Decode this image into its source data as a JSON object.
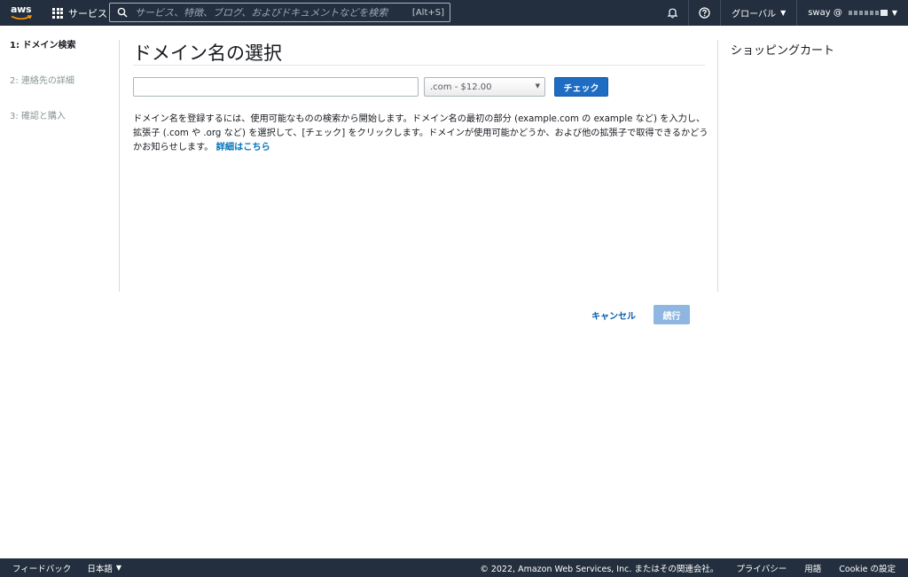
{
  "header": {
    "logo_text": "aws",
    "services_label": "サービス",
    "search_placeholder": "サービス、特徴、ブログ、およびドキュメントなどを検索",
    "search_shortcut": "[Alt+S]",
    "region_label": "グローバル",
    "account_label": "sway @"
  },
  "steps": [
    {
      "label": "1: ドメイン検索",
      "active": true
    },
    {
      "label": "2: 連絡先の詳細",
      "active": false
    },
    {
      "label": "3: 確認と購入",
      "active": false
    }
  ],
  "main": {
    "title": "ドメイン名の選択",
    "domain_input_value": "",
    "tld_selected": ".com - $12.00",
    "check_button": "チェック",
    "description": "ドメイン名を登録するには、使用可能なものの検索から開始します。ドメイン名の最初の部分 (example.com の example など) を入力し、拡張子 (.com や .org など) を選択して、[チェック] をクリックします。ドメインが使用可能かどうか、および他の拡張子で取得できるかどうかお知らせします。",
    "details_link": "詳細はこちら"
  },
  "cart": {
    "title": "ショッピングカート"
  },
  "actions": {
    "cancel": "キャンセル",
    "continue": "続行"
  },
  "footer": {
    "feedback": "フィードバック",
    "language": "日本語",
    "copyright": "© 2022, Amazon Web Services, Inc. またはその関連会社。",
    "privacy": "プライバシー",
    "terms": "用語",
    "cookie": "Cookie の設定"
  },
  "colors": {
    "nav_bg": "#232f3e",
    "primary_button": "#1f6dc2",
    "link": "#0073bb",
    "disabled_button": "#8fb6e0"
  }
}
